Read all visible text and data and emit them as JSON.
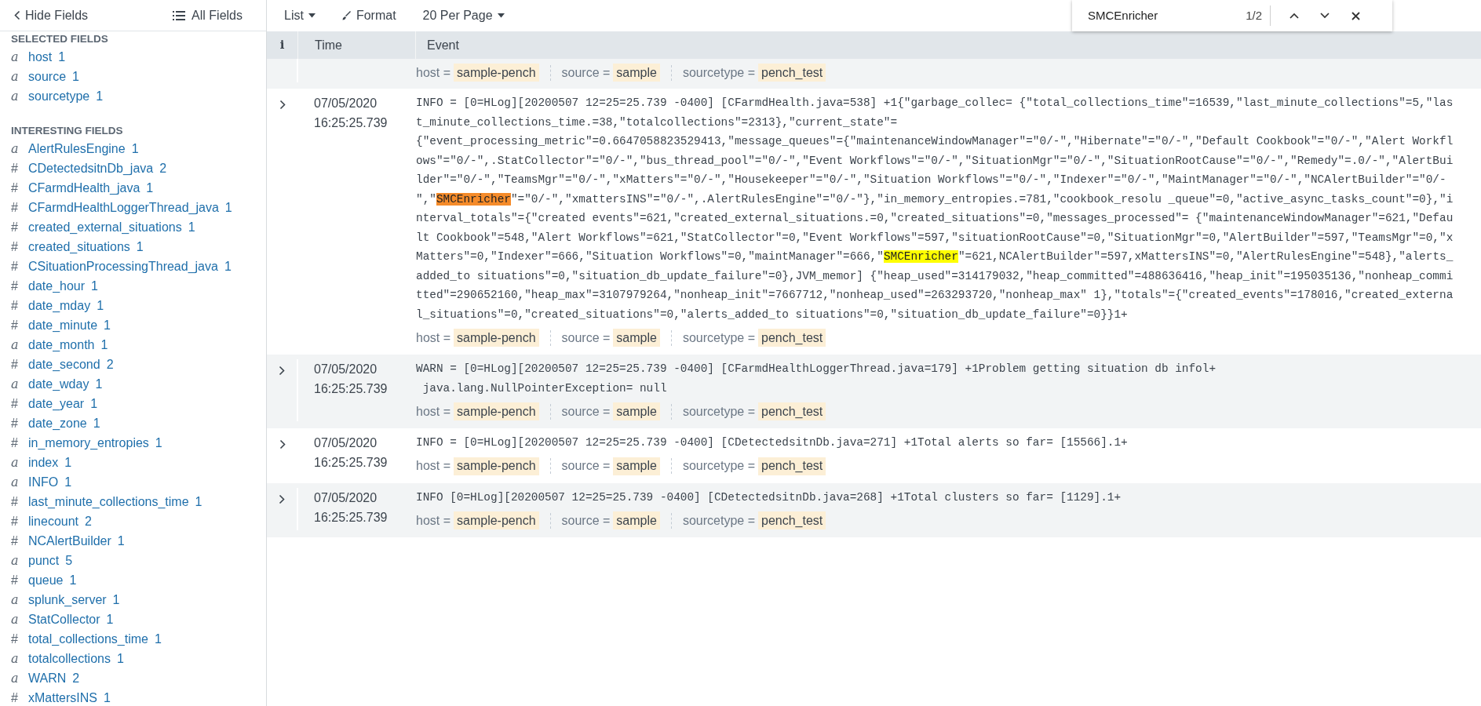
{
  "sidebar": {
    "hide_button": "Hide Fields",
    "all_fields_button": "All Fields",
    "sections": [
      {
        "title": "SELECTED FIELDS",
        "fields": [
          {
            "kind": "string",
            "marker": "a",
            "name": "host",
            "count": "1"
          },
          {
            "kind": "string",
            "marker": "a",
            "name": "source",
            "count": "1"
          },
          {
            "kind": "string",
            "marker": "a",
            "name": "sourcetype",
            "count": "1"
          }
        ]
      },
      {
        "title": "INTERESTING FIELDS",
        "fields": [
          {
            "kind": "string",
            "marker": "a",
            "name": "AlertRulesEngine",
            "count": "1"
          },
          {
            "kind": "number",
            "marker": "#",
            "name": "CDetectedsitnDb_java",
            "count": "2"
          },
          {
            "kind": "number",
            "marker": "#",
            "name": "CFarmdHealth_java",
            "count": "1"
          },
          {
            "kind": "number",
            "marker": "#",
            "name": "CFarmdHealthLoggerThread_java",
            "count": "1"
          },
          {
            "kind": "number",
            "marker": "#",
            "name": "created_external_situations",
            "count": "1"
          },
          {
            "kind": "number",
            "marker": "#",
            "name": "created_situations",
            "count": "1"
          },
          {
            "kind": "number",
            "marker": "#",
            "name": "CSituationProcessingThread_java",
            "count": "1"
          },
          {
            "kind": "number",
            "marker": "#",
            "name": "date_hour",
            "count": "1"
          },
          {
            "kind": "number",
            "marker": "#",
            "name": "date_mday",
            "count": "1"
          },
          {
            "kind": "number",
            "marker": "#",
            "name": "date_minute",
            "count": "1"
          },
          {
            "kind": "string",
            "marker": "a",
            "name": "date_month",
            "count": "1"
          },
          {
            "kind": "number",
            "marker": "#",
            "name": "date_second",
            "count": "2"
          },
          {
            "kind": "string",
            "marker": "a",
            "name": "date_wday",
            "count": "1"
          },
          {
            "kind": "number",
            "marker": "#",
            "name": "date_year",
            "count": "1"
          },
          {
            "kind": "number",
            "marker": "#",
            "name": "date_zone",
            "count": "1"
          },
          {
            "kind": "number",
            "marker": "#",
            "name": "in_memory_entropies",
            "count": "1"
          },
          {
            "kind": "string",
            "marker": "a",
            "name": "index",
            "count": "1"
          },
          {
            "kind": "string",
            "marker": "a",
            "name": "INFO",
            "count": "1"
          },
          {
            "kind": "number",
            "marker": "#",
            "name": "last_minute_collections_time",
            "count": "1"
          },
          {
            "kind": "number",
            "marker": "#",
            "name": "linecount",
            "count": "2"
          },
          {
            "kind": "number",
            "marker": "#",
            "name": "NCAlertBuilder",
            "count": "1"
          },
          {
            "kind": "string",
            "marker": "a",
            "name": "punct",
            "count": "5"
          },
          {
            "kind": "number",
            "marker": "#",
            "name": "queue",
            "count": "1"
          },
          {
            "kind": "string",
            "marker": "a",
            "name": "splunk_server",
            "count": "1"
          },
          {
            "kind": "string",
            "marker": "a",
            "name": "StatCollector",
            "count": "1"
          },
          {
            "kind": "number",
            "marker": "#",
            "name": "total_collections_time",
            "count": "1"
          },
          {
            "kind": "string",
            "marker": "a",
            "name": "totalcollections",
            "count": "1"
          },
          {
            "kind": "string",
            "marker": "a",
            "name": "WARN",
            "count": "2"
          },
          {
            "kind": "number",
            "marker": "#",
            "name": "xMattersINS",
            "count": "1"
          }
        ]
      }
    ]
  },
  "toolbar": [
    {
      "kind": "dropdown",
      "label": "List"
    },
    {
      "kind": "format",
      "label": "Format"
    },
    {
      "kind": "dropdown",
      "label": "20 Per Page"
    }
  ],
  "find_bar": {
    "query": "SMCEnricher",
    "count": "1/2"
  },
  "table": {
    "columns": [
      "i",
      "Time",
      "Event"
    ],
    "rows": [
      {
        "fields": [
          {
            "key": "host =",
            "value": "sample-pench"
          },
          {
            "key": "source =",
            "value": "sample"
          },
          {
            "key": "sourcetype =",
            "value": "pench_test"
          }
        ]
      },
      {
        "date": "07/05/2020",
        "time": "16:25:25.739",
        "lines": [
          [
            "INFO = [0=HLog][20200507 12=25=25.739 -0400] [CFarmdHealth.java=538] +1{\"garbage_collec= {\"total_collections_time\"=16539,\"last_minute_collections\"=5,\"las"
          ],
          [
            "t_minute_collections_time.=38,\"totalcollections\"=2313},\"current_state\"="
          ],
          [
            "{\"event_processing_metric\"=0.6647058823529413,\"message_queues\"={\"maintenanceWindowManager\"=\"0/-\",\"Hibernate\"=\"0/-\",\"Default Cookbook\"=\"0/-\",\"Alert Workfl"
          ],
          [
            "ows\"=\"0/-\",.StatCollector\"=\"0/-\",\"bus_thread_pool\"=\"0/-\",\"Event Workflows\"=\"0/-\",\"SituationMgr\"=\"0/-\",\"SituationRootCause\"=\"0/-\",\"Remedy\"=.0/-\",\"AlertBui"
          ],
          [
            "lder\"=\"0/-\",\"TeamsMgr\"=\"0/-\",\"xMatters\"=\"0/-\",\"Housekeeper\"=\"0/-\",\"Situation Workflows\"=\"0/-\",\"Indexer\"=\"0/-\",\"MaintManager\"=\"0/-\",\"NCAlertBuilder\"=\"0/-"
          ],
          [
            "\",\"",
            {
              "text": "SMCEnricher",
              "selected": true
            },
            "\"=\"0/-\",\"xmattersINS\"=\"0/-\",.AlertRulesEngine\"=\"0/-\"},\"in_memory_entropies.=781,\"cookbook_resolu _queue\"=0,\"active_async_tasks_count\"=0},\"i"
          ],
          [
            "nterval_totals\"={\"created events\"=621,\"created_external_situations.=0,\"created_situations\"=0,\"messages_processed\"= {\"maintenanceWindowManager\"=621,\"Defau"
          ],
          [
            "lt Cookbook\"=548,\"Alert Workflows\"=621,\"StatCollector\"=0,\"Event Workflows\"=597,\"situationRootCause\"=0,\"SituationMgr\"=0,\"AlertBuilder\"=597,\"TeamsMgr\"=0,\"x"
          ],
          [
            "Matters\"=0,\"Indexer\"=666,\"Situation Workflows\"=0,\"maintManager\"=666,\"",
            {
              "text": "SMCEnricher",
              "selected": false
            },
            "\"=621,NCAlertBuilder\"=597,xMattersINS\"=0,\"AlertRulesEngine\"=548},\"alerts_"
          ],
          [
            "added_to situations\"=0,\"situation_db_update_failure\"=0},JVM_memor] {\"heap_used\"=314179032,\"heap_committed\"=488636416,\"heap_init\"=195035136,\"nonheap_commi"
          ],
          [
            "tted\"=290652160,\"heap_max\"=3107979264,\"nonheap_init\"=7667712,\"nonheap_used\"=263293720,\"nonheap_max\" 1},\"totals\"={\"created_events\"=178016,\"created_externa"
          ],
          [
            "l_situations\"=0,\"created_situations\"=0,\"alerts_added_to situations\"=0,\"situation_db_update_failure\"=0}}1+"
          ]
        ],
        "fields": [
          {
            "key": "host =",
            "value": "sample-pench"
          },
          {
            "key": "source =",
            "value": "sample"
          },
          {
            "key": "sourcetype =",
            "value": "pench_test"
          }
        ]
      },
      {
        "date": "07/05/2020",
        "time": "16:25:25.739",
        "lines": [
          [
            "WARN = [0=HLog][20200507 12=25=25.739 -0400] [CFarmdHealthLoggerThread.java=179] +1Problem getting situation db infol+"
          ],
          [
            " java.lang.NullPointerException= null"
          ]
        ],
        "fields": [
          {
            "key": "host =",
            "value": "sample-pench"
          },
          {
            "key": "source =",
            "value": "sample"
          },
          {
            "key": "sourcetype =",
            "value": "pench_test"
          }
        ]
      },
      {
        "date": "07/05/2020",
        "time": "16:25:25.739",
        "lines": [
          [
            "INFO = [0=HLog][20200507 12=25=25.739 -0400] [CDetectedsitnDb.java=271] +1Total alerts so far= [15566].1+"
          ]
        ],
        "fields": [
          {
            "key": "host =",
            "value": "sample-pench"
          },
          {
            "key": "source =",
            "value": "sample"
          },
          {
            "key": "sourcetype =",
            "value": "pench_test"
          }
        ]
      },
      {
        "date": "07/05/2020",
        "time": "16:25:25.739",
        "lines": [
          [
            "INFO [0=HLog][20200507 12=25=25.739 -0400] [CDetectedsitnDb.java=268] +1Total clusters so far= [1129].1+"
          ]
        ],
        "fields": [
          {
            "key": "host =",
            "value": "sample-pench"
          },
          {
            "key": "source =",
            "value": "sample"
          },
          {
            "key": "sourcetype =",
            "value": "pench_test"
          }
        ]
      }
    ]
  }
}
